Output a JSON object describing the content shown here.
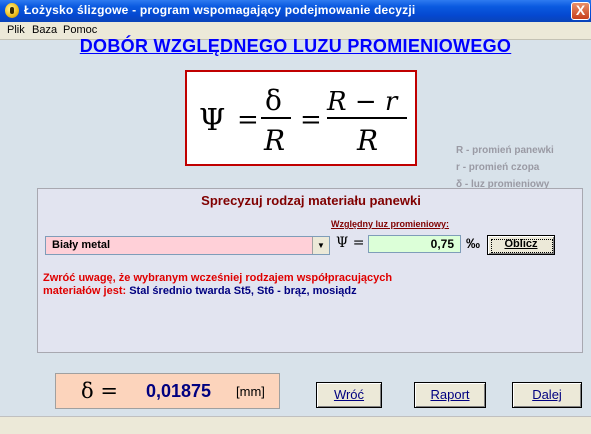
{
  "window": {
    "title": "Łożysko ślizgowe - program wspomagający podejmowanie decyzji",
    "close_label": "X"
  },
  "menu": {
    "items": [
      {
        "label": "Plik"
      },
      {
        "label": "Baza"
      },
      {
        "label": "Pomoc"
      }
    ]
  },
  "heading": "DOBÓR WZGLĘDNEGO LUZU PROMIENIOWEGO",
  "formula": {
    "psi": "Ψ",
    "eq": "=",
    "delta": "δ",
    "R": "R",
    "R_minus_r": "R − r"
  },
  "legend": {
    "items": [
      {
        "symbol": "R",
        "text": "- promień panewki"
      },
      {
        "symbol": "r",
        "text": "- promień czopa"
      },
      {
        "symbol": "δ",
        "text": "- luz promieniowy"
      }
    ]
  },
  "material": {
    "title": "Sprecyzuj rodzaj materiału panewki",
    "selected": "Biały metal",
    "luz_label": "Względny luz promieniowy:",
    "psi_eq": "Ψ =",
    "psi_value": "0,75",
    "unit": "‰",
    "oblicz_label": "Oblicz",
    "warning_line1": "Zwróć uwagę, że wybranym wcześniej rodzajem współpracujących",
    "warning_line2": "materiałów jest:",
    "materials_pair": "Stal średnio twarda St5, St6 - brąz, mosiądz"
  },
  "result": {
    "delta_symbol": "δ =",
    "value": "0,01875",
    "unit": "[mm]"
  },
  "buttons": {
    "back": "Wróć",
    "report": "Raport",
    "next": "Dalej"
  },
  "colors": {
    "heading": "#0000ff",
    "formula_border": "#c00000",
    "panel_title": "#800000",
    "warning": "#e00000",
    "material_text": "#000080"
  }
}
